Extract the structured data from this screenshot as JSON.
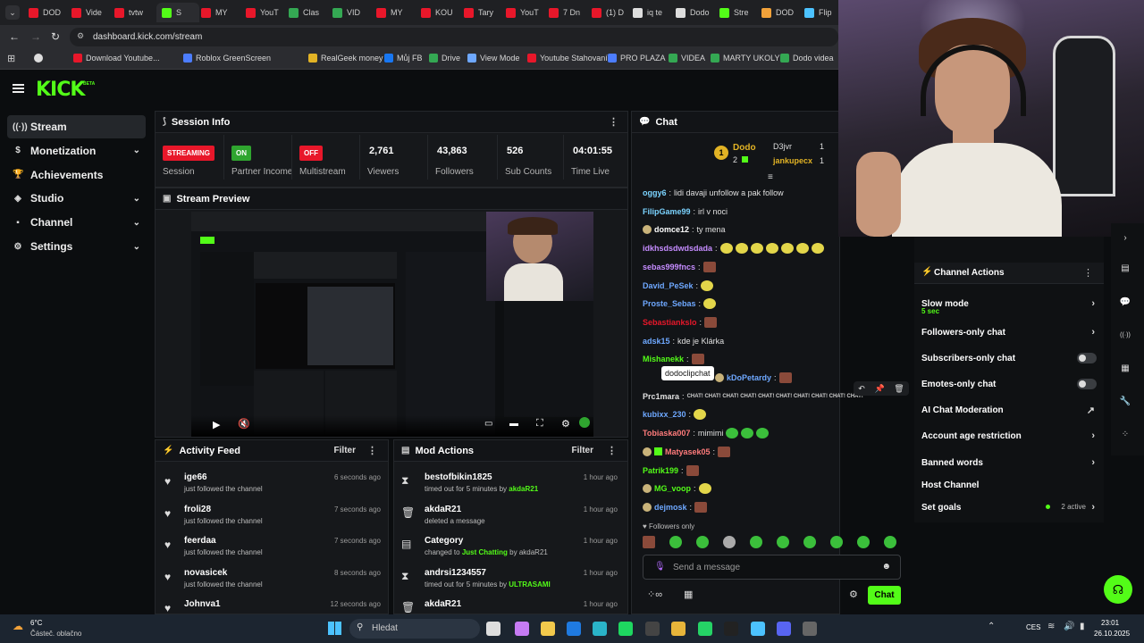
{
  "browser": {
    "tabs": [
      "DOD",
      "Vide",
      "tvtw",
      "S",
      "MY",
      "YouT",
      "Clas",
      "VID",
      "MY",
      "KOU",
      "Tary",
      "YouT",
      "7 Dn",
      "(1) D",
      "iq te",
      "Dodo",
      "Stre",
      "DOD",
      "Flip"
    ],
    "url": "dashboard.kick.com/stream",
    "bookmarks": [
      "Download Youtube...",
      "Roblox GreenScreen",
      "RealGeek money",
      "Můj FB",
      "Drive",
      "View Mode",
      "Youtube Stahovaní",
      "PRO PLAZA",
      "VIDEA",
      "MARTY UKOLY",
      "Dodo videa"
    ]
  },
  "brand": {
    "logo": "KICK",
    "beta": "BETA",
    "color": "#53fc18"
  },
  "sidebar": {
    "items": [
      {
        "label": "Stream",
        "icon": "stream-icon",
        "expandable": false,
        "active": true
      },
      {
        "label": "Monetization",
        "icon": "monetization-icon",
        "expandable": true
      },
      {
        "label": "Achievements",
        "icon": "trophy-icon",
        "expandable": false
      },
      {
        "label": "Studio",
        "icon": "studio-icon",
        "expandable": true
      },
      {
        "label": "Channel",
        "icon": "channel-icon",
        "expandable": true
      },
      {
        "label": "Settings",
        "icon": "gear-icon",
        "expandable": true
      }
    ]
  },
  "session": {
    "title": "Session Info",
    "items": [
      {
        "badge": "STREAMING",
        "badge_color": "#e8172a",
        "label": "Session"
      },
      {
        "badge": "ON",
        "badge_color": "#2fa52f",
        "label": "Partner Income"
      },
      {
        "badge": "OFF",
        "badge_color": "#e8172a",
        "label": "Multistream"
      },
      {
        "value": "2,761",
        "label": "Viewers"
      },
      {
        "value": "43,863",
        "label": "Followers"
      },
      {
        "value": "526",
        "label": "Sub Counts"
      },
      {
        "value": "04:01:55",
        "label": "Time Live"
      }
    ]
  },
  "preview": {
    "title": "Stream Preview"
  },
  "activity": {
    "title": "Activity Feed",
    "filter": "Filter",
    "rows": [
      {
        "name": "ige66",
        "text": "just followed the channel",
        "time": "6 seconds ago"
      },
      {
        "name": "froli28",
        "text": "just followed the channel",
        "time": "7 seconds ago"
      },
      {
        "name": "feerdaa",
        "text": "just followed the channel",
        "time": "7 seconds ago"
      },
      {
        "name": "novasicek",
        "text": "just followed the channel",
        "time": "8 seconds ago"
      },
      {
        "name": "Johnva1",
        "text": "",
        "time": "12 seconds ago"
      }
    ]
  },
  "mod": {
    "title": "Mod Actions",
    "filter": "Filter",
    "rows": [
      {
        "icon": "hourglass-icon",
        "name": "bestofbikin1825",
        "pre": "timed out for 5 minutes by ",
        "green": "akdaR21",
        "post": "",
        "time": "1 hour ago"
      },
      {
        "icon": "trash-icon",
        "name": "akdaR21",
        "pre": "deleted a message",
        "green": "",
        "post": "",
        "time": "1 hour ago"
      },
      {
        "icon": "category-icon",
        "name": "Category",
        "pre": "changed to ",
        "green": "Just Chatting",
        "post": " by akdaR21",
        "time": "1 hour ago"
      },
      {
        "icon": "hourglass-icon",
        "name": "andrsi1234557",
        "pre": "timed out for 5 minutes by ",
        "green": "ULTRASAMI",
        "post": "",
        "time": "1 hour ago"
      },
      {
        "icon": "trash-icon",
        "name": "akdaR21",
        "pre": "",
        "green": "",
        "post": "",
        "time": "1 hour ago"
      }
    ]
  },
  "chat": {
    "title": "Chat",
    "leaderboard": {
      "rank": "1",
      "name": "Dodo",
      "count": "2",
      "users": [
        {
          "name": "D3jvr",
          "count": "1"
        },
        {
          "name": "jankupecx",
          "count": "1"
        }
      ]
    },
    "messages": [
      {
        "user": "oggy6",
        "color": "#7bd3ff",
        "text": "lidi davaji unfollow a pak follow",
        "emotes": 0
      },
      {
        "user": "FilipGame99",
        "color": "#7bd3ff",
        "text": "irl v noci",
        "emotes": 0
      },
      {
        "user": "domce12",
        "color": "#ffffff",
        "text": "ty mena",
        "emotes": 0
      },
      {
        "user": "idkhsdsdwdsdada",
        "color": "#c58cff",
        "text": "",
        "emotes": 7
      },
      {
        "user": "sebas999fncs",
        "color": "#c58cff",
        "text": "",
        "emotes": 1
      },
      {
        "user": "David_PeSek",
        "color": "#6ea8ff",
        "text": "",
        "emotes": 1
      },
      {
        "user": "Proste_Sebas",
        "color": "#6ea8ff",
        "text": "",
        "emotes": 1
      },
      {
        "user": "Sebastiankslo",
        "color": "#e8172a",
        "text": "",
        "emotes": 1
      },
      {
        "user": "adsk15",
        "color": "#6ea8ff",
        "text": "kde je Klárka",
        "emotes": 0
      },
      {
        "user": "Mishanekk",
        "color": "#53fc18",
        "text": "",
        "emotes": 1
      },
      {
        "user": "kDoPetardy",
        "color": "#6ea8ff",
        "text": "",
        "emotes": 1
      },
      {
        "user": "Prc1mara",
        "color": "#e0e0e0",
        "text": "CHAT! CHAT! CHAT! CHAT! CHAT! CHAT! CHAT! CHAT! CHAT! CHAT!",
        "emotes": 0
      },
      {
        "user": "kubixx_230",
        "color": "#6ea8ff",
        "text": "",
        "emotes": 1
      },
      {
        "user": "Tobiaska007",
        "color": "#ff7b7b",
        "text": "mimimi",
        "emotes": 3
      },
      {
        "user": "Matyasek05",
        "color": "#ff7b7b",
        "text": "",
        "emotes": 1
      },
      {
        "user": "Patrik199",
        "color": "#53fc18",
        "text": "",
        "emotes": 1
      },
      {
        "user": "MG_voop",
        "color": "#53fc18",
        "text": "",
        "emotes": 1
      },
      {
        "user": "dejmosk",
        "color": "#6ea8ff",
        "text": "",
        "emotes": 1
      }
    ],
    "tooltip": "dodoclipchat",
    "followers_only": "Followers only",
    "input_placeholder": "Send a message",
    "send_label": "Chat"
  },
  "channel_actions": {
    "title": "Channel Actions",
    "items": [
      {
        "label": "Slow mode",
        "sub": "5 sec",
        "control": "chevron"
      },
      {
        "label": "Followers-only chat",
        "sub": "",
        "control": "chevron"
      },
      {
        "label": "Subscribers-only chat",
        "sub": "",
        "control": "toggle"
      },
      {
        "label": "Emotes-only chat",
        "sub": "",
        "control": "toggle"
      },
      {
        "label": "AI Chat Moderation",
        "sub": "",
        "control": "external"
      },
      {
        "label": "Account age restriction",
        "sub": "",
        "control": "chevron"
      },
      {
        "label": "Banned words",
        "sub": "",
        "control": "chevron"
      },
      {
        "label": "Host Channel",
        "sub": "",
        "control": "none"
      },
      {
        "label": "Set goals",
        "sub": "",
        "control": "goals",
        "extra": "2 active"
      }
    ]
  },
  "taskbar": {
    "weather_temp": "6°C",
    "weather_desc": "Částeč. oblačno",
    "search_placeholder": "Hledat",
    "lang": "CES",
    "time": "23:01",
    "date": "26.10.2025"
  }
}
